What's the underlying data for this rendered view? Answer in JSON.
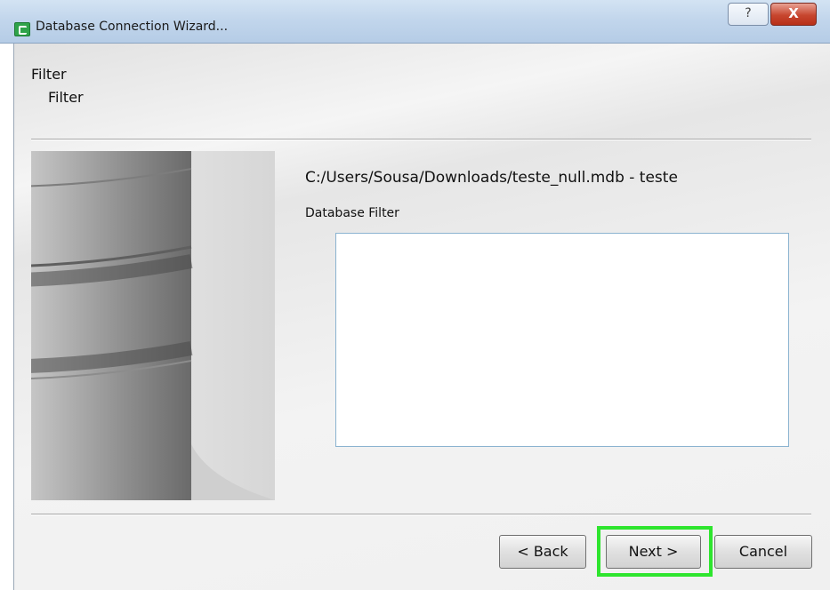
{
  "window": {
    "title": "Database Connection Wizard...",
    "help_label": "?",
    "close_label": "X"
  },
  "header": {
    "title": "Filter",
    "subtitle": "Filter"
  },
  "main": {
    "database_path": "C:/Users/Sousa/Downloads/teste_null.mdb - teste",
    "filter_label": "Database Filter",
    "filter_value": ""
  },
  "buttons": {
    "back": "< Back",
    "next": "Next >",
    "cancel": "Cancel"
  },
  "highlight_color": "#2ee52e",
  "icons": {
    "app": "app-icon",
    "help": "help-icon",
    "close": "close-icon",
    "illustration": "database-cylinder-icon"
  }
}
